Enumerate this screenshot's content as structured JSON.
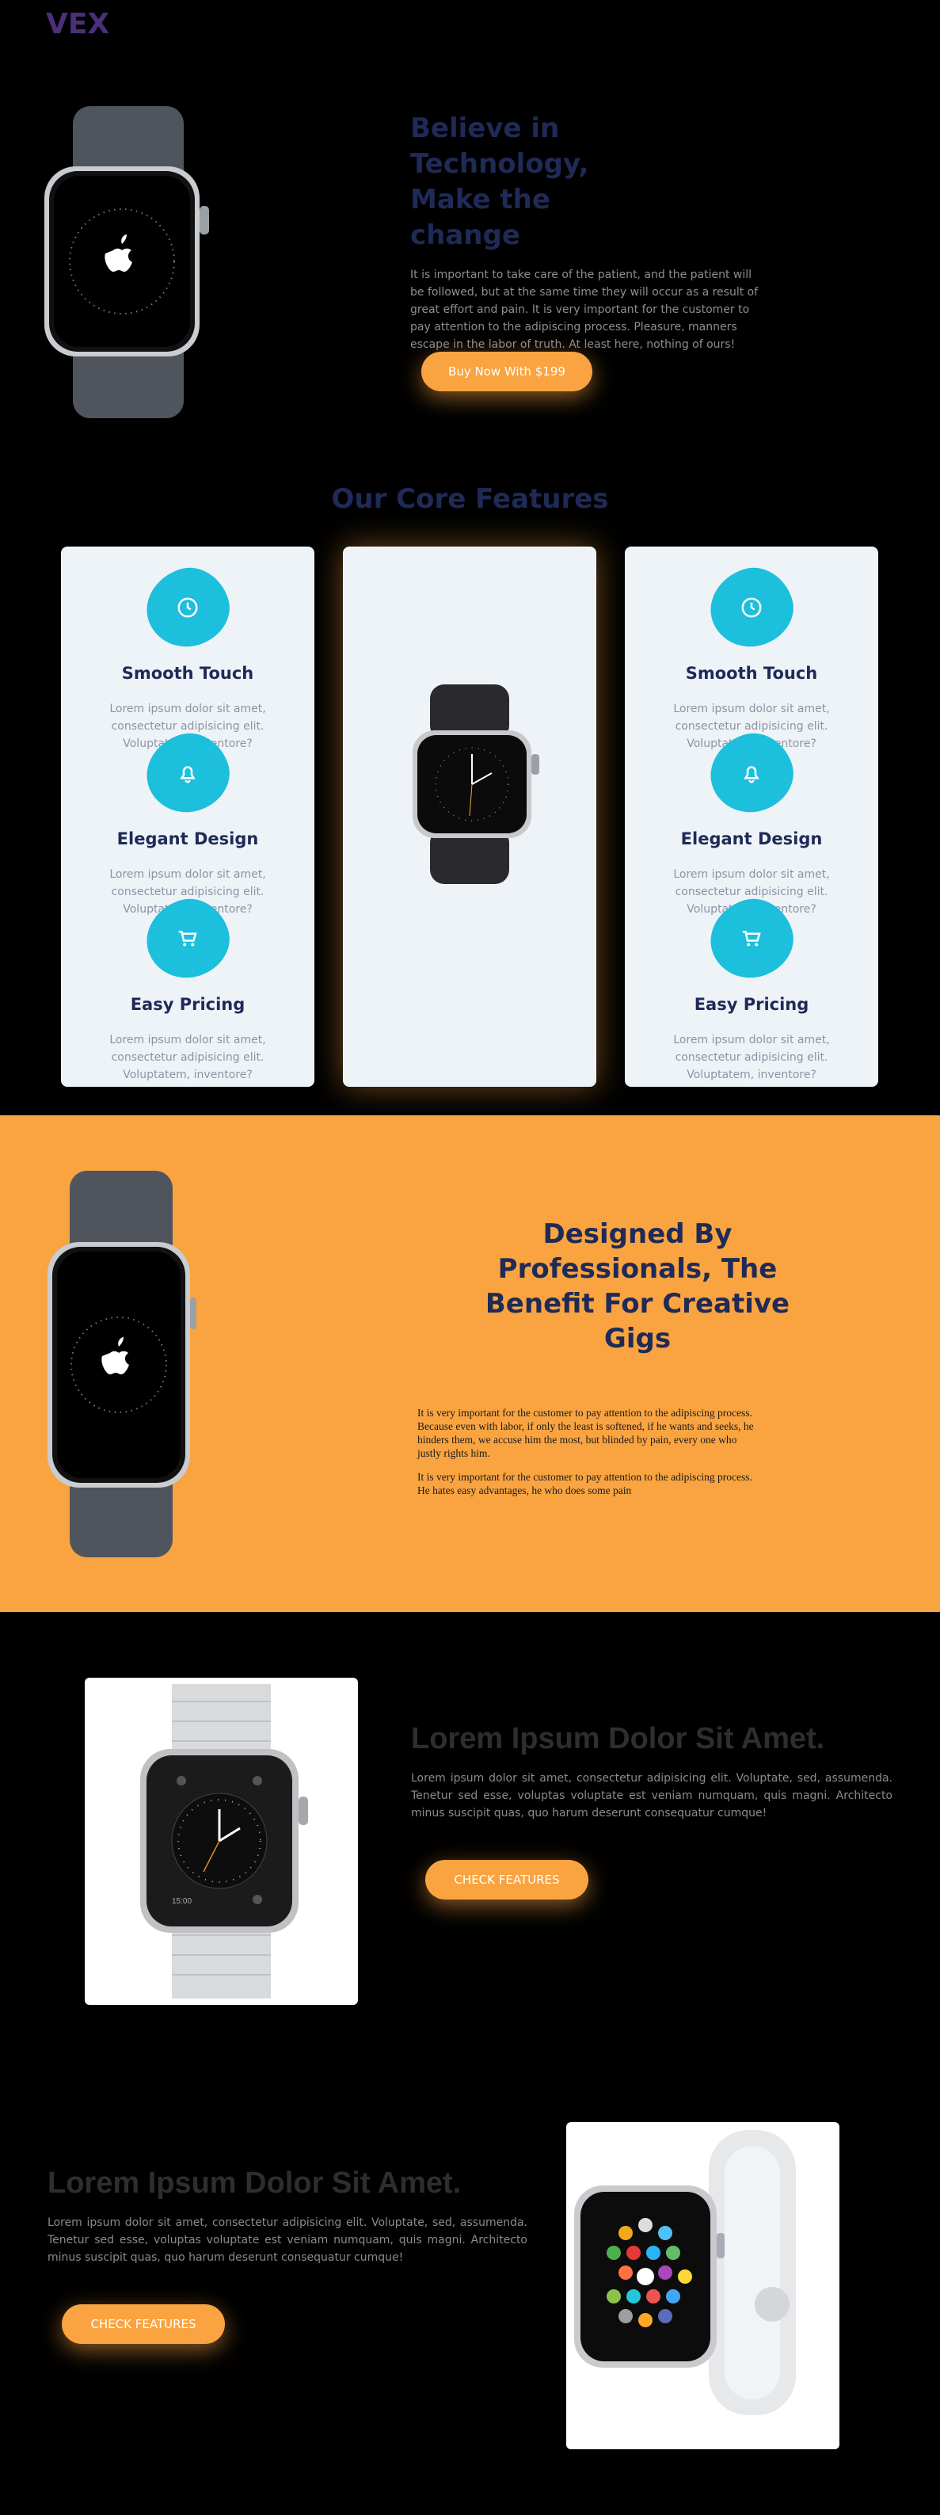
{
  "header": {
    "logo": "VEX"
  },
  "hero": {
    "title": "Believe in Technology, Make the change",
    "description": "It is important to take care of the patient, and the patient will be followed, but at the same time they will occur as a result of great effort and pain. It is very important for the customer to pay attention to the adipiscing process. Pleasure, manners escape in the labor of truth. At least here, nothing of ours!",
    "button": "Buy Now With $199"
  },
  "features": {
    "title": "Our Core Features",
    "left": [
      {
        "icon": "clock-icon",
        "title": "Smooth Touch",
        "text": "Lorem ipsum dolor sit amet, consectetur adipisicing elit. Voluptatem, inventore?"
      },
      {
        "icon": "bell-icon",
        "title": "Elegant Design",
        "text": "Lorem ipsum dolor sit amet, consectetur adipisicing elit. Voluptatem, inventore?"
      },
      {
        "icon": "cart-icon",
        "title": "Easy Pricing",
        "text": "Lorem ipsum dolor sit amet, consectetur adipisicing elit. Voluptatem, inventore?"
      }
    ],
    "right": [
      {
        "icon": "clock-icon",
        "title": "Smooth Touch",
        "text": "Lorem ipsum dolor sit amet, consectetur adipisicing elit. Voluptatem, inventore?"
      },
      {
        "icon": "bell-icon",
        "title": "Elegant Design",
        "text": "Lorem ipsum dolor sit amet, consectetur adipisicing elit. Voluptatem, inventore?"
      },
      {
        "icon": "cart-icon",
        "title": "Easy Pricing",
        "text": "Lorem ipsum dolor sit amet, consectetur adipisicing elit. Voluptatem, inventore?"
      }
    ]
  },
  "designed": {
    "title": "Designed By Professionals, The Benefit For Creative Gigs",
    "p1": "It is very important for the customer to pay attention to the adipiscing process. Because even with labor, if only the least is softened, if he wants and seeks, he hinders them, we accuse him the most, but blinded by pain, every one who justly rights him.",
    "p2": "It is very important for the customer to pay attention to the adipiscing process. He hates easy advantages, he who does some pain"
  },
  "product_a": {
    "title": "Lorem Ipsum Dolor Sit Amet.",
    "description": "Lorem ipsum dolor sit amet, consectetur adipisicing elit. Voluptate, sed, assumenda. Tenetur sed esse, voluptas voluptate est veniam numquam, quis magni. Architecto minus suscipit quas, quo harum deserunt consequatur cumque!",
    "button": "CHECK FEATURES",
    "watch_time": "15:00"
  },
  "product_b": {
    "title": "Lorem Ipsum Dolor Sit Amet.",
    "description": "Lorem ipsum dolor sit amet, consectetur adipisicing elit. Voluptate, sed, assumenda. Tenetur sed esse, voluptas voluptate est veniam numquam, quis magni. Architecto minus suscipit quas, quo harum deserunt consequatur cumque!",
    "button": "CHECK FEATURES"
  },
  "colors": {
    "accent": "#f9a440",
    "navy": "#1f2a57",
    "cyan": "#1cbfdc",
    "logo": "#4b2f7a"
  }
}
